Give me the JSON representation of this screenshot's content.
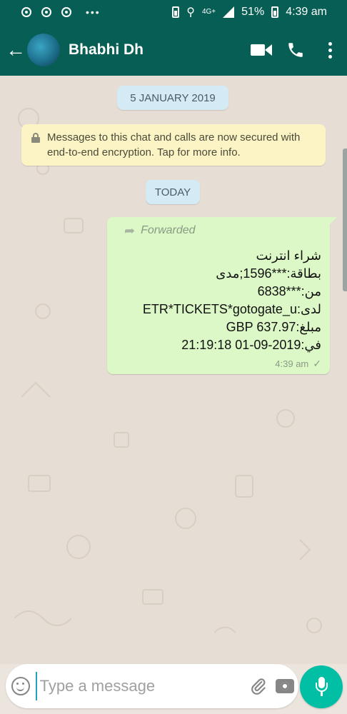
{
  "status_bar": {
    "network": "4G+",
    "battery": "51%",
    "time": "4:39 am"
  },
  "header": {
    "contact_name": "Bhabhi Dh"
  },
  "chat": {
    "date_chip": "5 JANUARY 2019",
    "encryption_notice": "Messages to this chat and calls are now secured with end-to-end encryption. Tap for more info.",
    "today_chip": "TODAY",
    "message": {
      "forwarded_label": "Forwarded",
      "lines": [
        "شراء انترنت",
        "بطاقة:***1596;مدى",
        "من:***6838",
        "لدى:ETR*TICKETS*gotogate_u",
        "مبلغ:GBP 637.97",
        "في:2019-09-01 21:19:18"
      ],
      "time": "4:39 am",
      "status_icon": "single-check"
    }
  },
  "composer": {
    "placeholder": "Type a message"
  },
  "colors": {
    "header": "#075e54",
    "outgoing_bubble": "#dcf8c6",
    "mic_button": "#00bfa5"
  }
}
